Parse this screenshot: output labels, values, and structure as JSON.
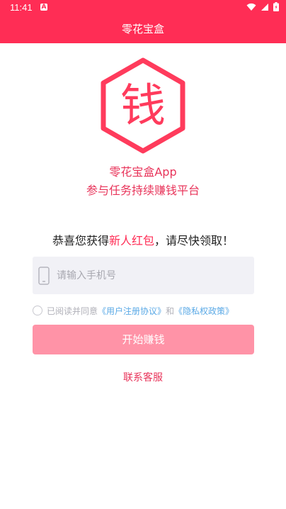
{
  "status_bar": {
    "time": "11:41",
    "notification_letter": "A"
  },
  "app_bar": {
    "title": "零花宝盒"
  },
  "logo": {
    "glyph": "钱",
    "color": "#ff3b5c"
  },
  "intro": {
    "app_name": "零花宝盒App",
    "slogan": "参与任务持续赚钱平台"
  },
  "welcome": {
    "prefix": "恭喜您获得",
    "highlight": "新人红包",
    "suffix": "，请尽快领取！"
  },
  "phone_field": {
    "placeholder": "请输入手机号",
    "value": ""
  },
  "agreement": {
    "prefix": "已阅读并同意",
    "user_agreement": "《用户注册协议》",
    "conjunction": "和",
    "privacy_policy": "《隐私权政策》"
  },
  "start_button": {
    "label": "开始赚钱"
  },
  "contact": {
    "label": "联系客服"
  },
  "colors": {
    "brand": "#ff2d55",
    "button_disabled": "#ff93a7",
    "link": "#5aa9e6"
  }
}
